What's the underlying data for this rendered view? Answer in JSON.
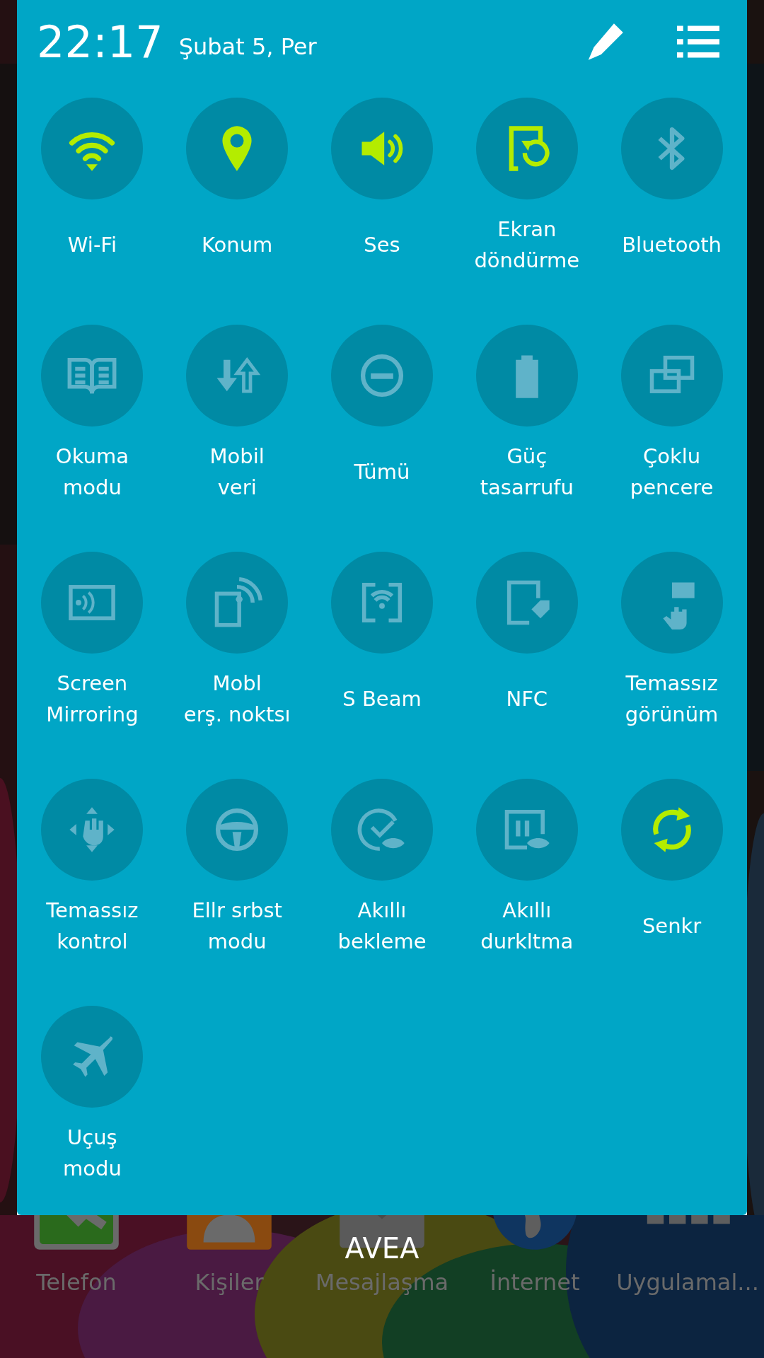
{
  "status": {
    "time": "22:17",
    "date": "Şubat 5, Per"
  },
  "toggles": [
    {
      "kind": "wifi",
      "label": "Wi-Fi",
      "on": true
    },
    {
      "kind": "location",
      "label": "Konum",
      "on": true
    },
    {
      "kind": "sound",
      "label": "Ses",
      "on": true
    },
    {
      "kind": "rotate",
      "label": "Ekran\ndöndürme",
      "on": true
    },
    {
      "kind": "bluetooth",
      "label": "Bluetooth",
      "on": false
    },
    {
      "kind": "book",
      "label": "Okuma\nmodu",
      "on": false
    },
    {
      "kind": "data",
      "label": "Mobil\nveri",
      "on": false
    },
    {
      "kind": "dnd",
      "label": "Tümü",
      "on": false
    },
    {
      "kind": "battery",
      "label": "Güç\ntasarrufu",
      "on": false
    },
    {
      "kind": "multiwindow",
      "label": "Çoklu\npencere",
      "on": false
    },
    {
      "kind": "mirroring",
      "label": "Screen\nMirroring",
      "on": false
    },
    {
      "kind": "hotspot",
      "label": "Mobl\nerş. noktsı",
      "on": false
    },
    {
      "kind": "sbeam",
      "label": "S Beam",
      "on": false
    },
    {
      "kind": "nfc",
      "label": "NFC",
      "on": false
    },
    {
      "kind": "airview",
      "label": "Temassız\ngörünüm",
      "on": false
    },
    {
      "kind": "airgesture",
      "label": "Temassız\nkontrol",
      "on": false
    },
    {
      "kind": "driving",
      "label": "Ellr srbst\nmodu",
      "on": false
    },
    {
      "kind": "smartstay",
      "label": "Akıllı\nbekleme",
      "on": false
    },
    {
      "kind": "smartpause",
      "label": "Akıllı\ndurkltma",
      "on": false
    },
    {
      "kind": "sync",
      "label": "Senkr",
      "on": true
    },
    {
      "kind": "plane",
      "label": "Uçuş\nmodu",
      "on": false
    }
  ],
  "carrier": "AVEA",
  "dock": [
    {
      "kind": "phone",
      "label": "Telefon"
    },
    {
      "kind": "contacts",
      "label": "Kişiler"
    },
    {
      "kind": "messages",
      "label": "Mesajlaşma"
    },
    {
      "kind": "internet",
      "label": "İnternet"
    },
    {
      "kind": "apps",
      "label": "Uygulamal..."
    }
  ]
}
